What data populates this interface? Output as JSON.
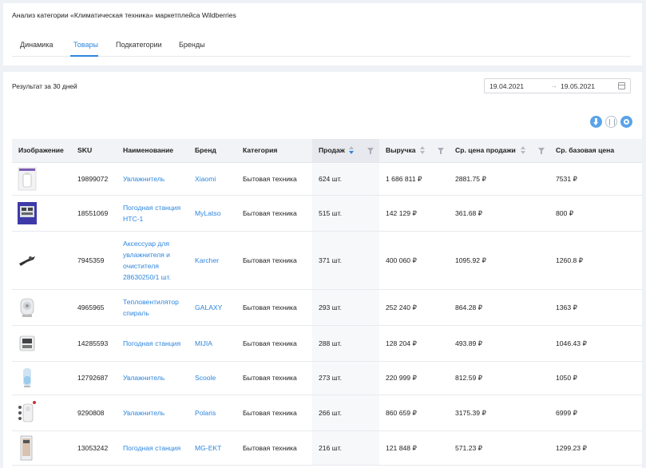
{
  "page": {
    "title": "Анализ категории «Климатическая техника» маркетплейса Wildberries"
  },
  "tabs": [
    {
      "label": "Динамика",
      "active": false
    },
    {
      "label": "Товары",
      "active": true
    },
    {
      "label": "Подкатегории",
      "active": false
    },
    {
      "label": "Бренды",
      "active": false
    }
  ],
  "result_label": "Результат за 30 дней",
  "date_range": {
    "from": "19.04.2021",
    "arrow": "→",
    "to": "19.05.2021"
  },
  "table": {
    "columns": [
      "Изображение",
      "SKU",
      "Наименование",
      "Бренд",
      "Категория",
      "Продаж",
      "Выручка",
      "Ср. цена продажи",
      "Ср. базовая цена"
    ],
    "rows": [
      {
        "sku": "19899072",
        "name": "Увлажнитель",
        "brand": "Xiaomi",
        "category": "Бытовая техника",
        "sales": "624 шт.",
        "revenue": "1 686 811 ₽",
        "avg_price": "2881.75 ₽",
        "base_price": "7531 ₽",
        "image": "humidifier-box"
      },
      {
        "sku": "18551069",
        "name": "Погодная станция HTC-1",
        "brand": "MyLatso",
        "category": "Бытовая техника",
        "sales": "515 шт.",
        "revenue": "142 129 ₽",
        "avg_price": "361.68 ₽",
        "base_price": "800 ₽",
        "image": "weather-station-box"
      },
      {
        "sku": "7945359",
        "name": "Аксессуар для увлажнителя и очистителя 28630250/1 шт.",
        "brand": "Karcher",
        "category": "Бытовая техника",
        "sales": "371 шт.",
        "revenue": "400 060 ₽",
        "avg_price": "1095.92 ₽",
        "base_price": "1260.8 ₽",
        "image": "accessory-nozzle"
      },
      {
        "sku": "4965965",
        "name": "Тепловентилятор спираль",
        "brand": "GALAXY",
        "category": "Бытовая техника",
        "sales": "293 шт.",
        "revenue": "252 240 ₽",
        "avg_price": "864.28 ₽",
        "base_price": "1363 ₽",
        "image": "fan-heater"
      },
      {
        "sku": "14285593",
        "name": "Погодная станция",
        "brand": "MIJIA",
        "category": "Бытовая техника",
        "sales": "288 шт.",
        "revenue": "128 204 ₽",
        "avg_price": "493.89 ₽",
        "base_price": "1046.43 ₽",
        "image": "weather-station"
      },
      {
        "sku": "12792687",
        "name": "Увлажнитель",
        "brand": "Scoole",
        "category": "Бытовая техника",
        "sales": "273 шт.",
        "revenue": "220 999 ₽",
        "avg_price": "812.59 ₽",
        "base_price": "1050 ₽",
        "image": "humidifier-blue"
      },
      {
        "sku": "9290808",
        "name": "Увлажнитель",
        "brand": "Polaris",
        "category": "Бытовая техника",
        "sales": "266 шт.",
        "revenue": "860 659 ₽",
        "avg_price": "3175.39 ₽",
        "base_price": "6999 ₽",
        "image": "humidifier-white"
      },
      {
        "sku": "13053242",
        "name": "Погодная станция",
        "brand": "MG-EKT",
        "category": "Бытовая техника",
        "sales": "216 шт.",
        "revenue": "121 848 ₽",
        "avg_price": "571.23 ₽",
        "base_price": "1299.23 ₽",
        "image": "weather-station-tall"
      }
    ]
  },
  "colors": {
    "accent": "#2e86de",
    "background": "#eef1f6",
    "header_bg": "#f2f3f6"
  }
}
